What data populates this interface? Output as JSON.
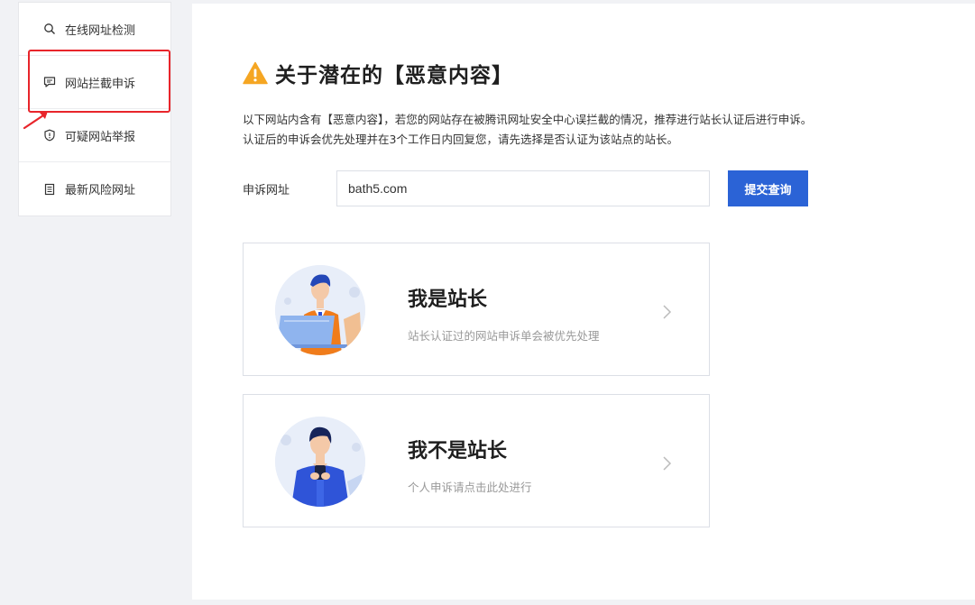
{
  "sidebar": {
    "items": [
      {
        "label": "在线网址检测",
        "icon": "search-icon"
      },
      {
        "label": "网站拦截申诉",
        "icon": "comment-icon"
      },
      {
        "label": "可疑网站举报",
        "icon": "shield-icon"
      },
      {
        "label": "最新风险网址",
        "icon": "document-icon"
      }
    ]
  },
  "main": {
    "title": "关于潜在的【恶意内容】",
    "desc_line1": "以下网站内含有【恶意内容】，若您的网站存在被腾讯网址安全中心误拦截的情况，推荐进行站长认证后进行申诉。",
    "desc_line2": "认证后的申诉会优先处理并在3个工作日内回复您，请先选择是否认证为该站点的站长。",
    "form": {
      "label": "申诉网址",
      "value": "bath5.com",
      "submit_label": "提交查询"
    },
    "cards": [
      {
        "title": "我是站长",
        "subtitle": "站长认证过的网站申诉单会被优先处理"
      },
      {
        "title": "我不是站长",
        "subtitle": "个人申诉请点击此处进行"
      }
    ]
  },
  "colors": {
    "primary": "#2b63d6",
    "warning": "#f5a623",
    "highlight": "#e8252b"
  }
}
